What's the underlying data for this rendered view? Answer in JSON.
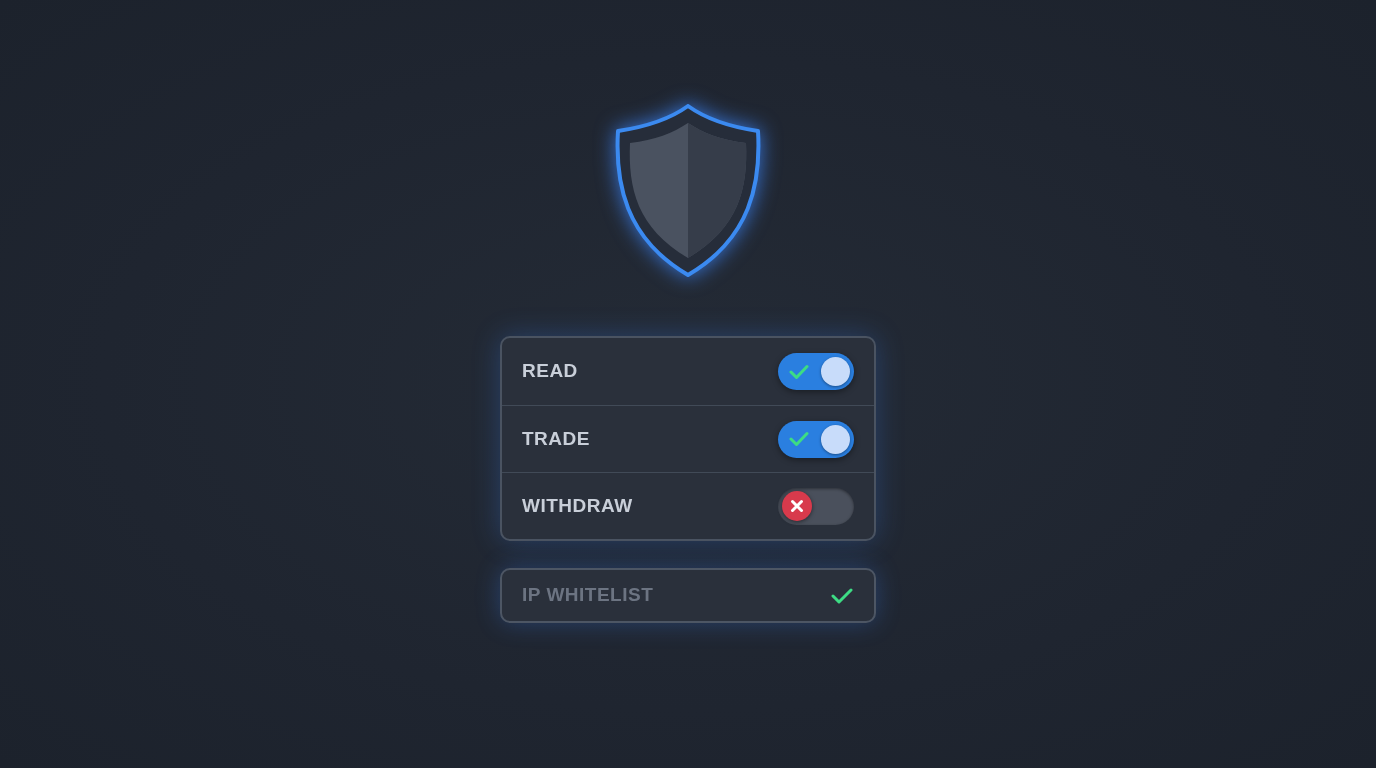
{
  "permissions": [
    {
      "label": "READ",
      "on": true
    },
    {
      "label": "TRADE",
      "on": true
    },
    {
      "label": "WITHDRAW",
      "on": false
    }
  ],
  "ip_whitelist": {
    "label": "IP WHITELIST",
    "checked": true
  }
}
